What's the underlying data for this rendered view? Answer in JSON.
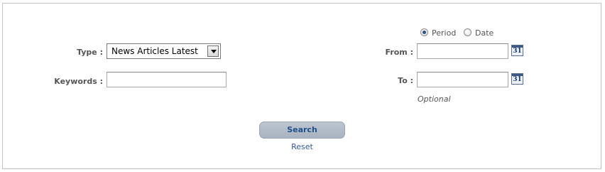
{
  "form": {
    "type_label": "Type :",
    "type_selected": "News Articles Latest",
    "keywords_label": "Keywords :",
    "keywords_value": "",
    "range_mode": {
      "options": [
        "Period",
        "Date"
      ],
      "selected": "Period"
    },
    "from_label": "From :",
    "from_value": "",
    "to_label": "To :",
    "to_value": "",
    "optional_note": "Optional",
    "calendar_icon_text": "31",
    "search_label": "Search",
    "reset_label": "Reset"
  },
  "icons": {
    "dropdown": "chevron-down-icon",
    "calendar": "calendar-icon"
  },
  "colors": {
    "label_text": "#555555",
    "search_button_bg": "#b1bbc7",
    "search_button_text": "#1f4f8a",
    "link": "#2f5d92",
    "border": "#c4c4c4"
  }
}
